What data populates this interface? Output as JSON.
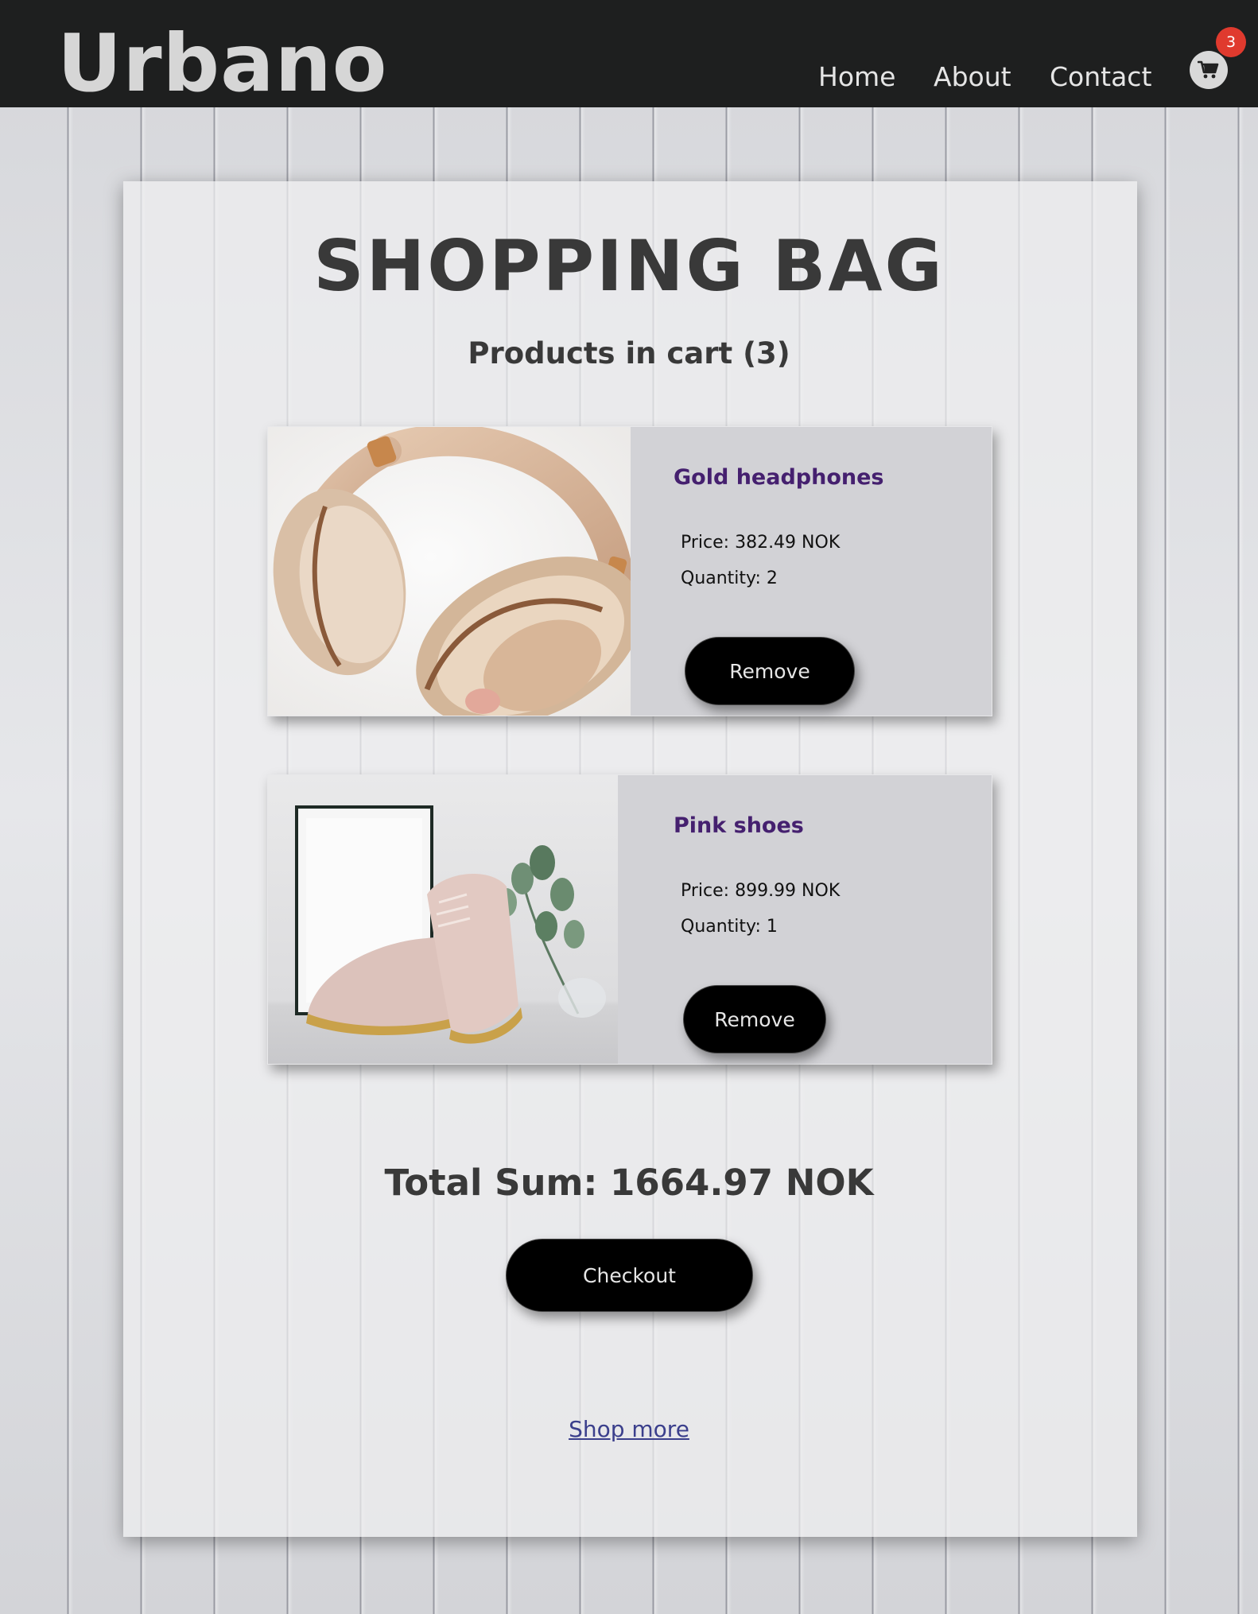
{
  "header": {
    "logo": "Urbano",
    "nav": [
      "Home",
      "About",
      "Contact"
    ],
    "cart_icon": "cart-icon",
    "cart_count": "3"
  },
  "main": {
    "title": "SHOPPING BAG",
    "subtitle": "Products in cart (3)",
    "products": [
      {
        "name": "Gold headphones",
        "price": "Price: 382.49 NOK",
        "quantity": "Quantity: 2",
        "remove_label": "Remove",
        "image": "gold-headphones-photo"
      },
      {
        "name": "Pink shoes",
        "price": "Price: 899.99 NOK",
        "quantity": "Quantity: 1",
        "remove_label": "Remove",
        "image": "pink-shoes-photo"
      }
    ],
    "total": "Total Sum: 1664.97 NOK",
    "checkout_label": "Checkout",
    "shop_more_label": "Shop more"
  },
  "colors": {
    "header_bg": "#1e1f1f",
    "product_name": "#45206f",
    "badge": "#e03a2e",
    "button_bg": "#000000",
    "link": "#3b3f8c"
  }
}
